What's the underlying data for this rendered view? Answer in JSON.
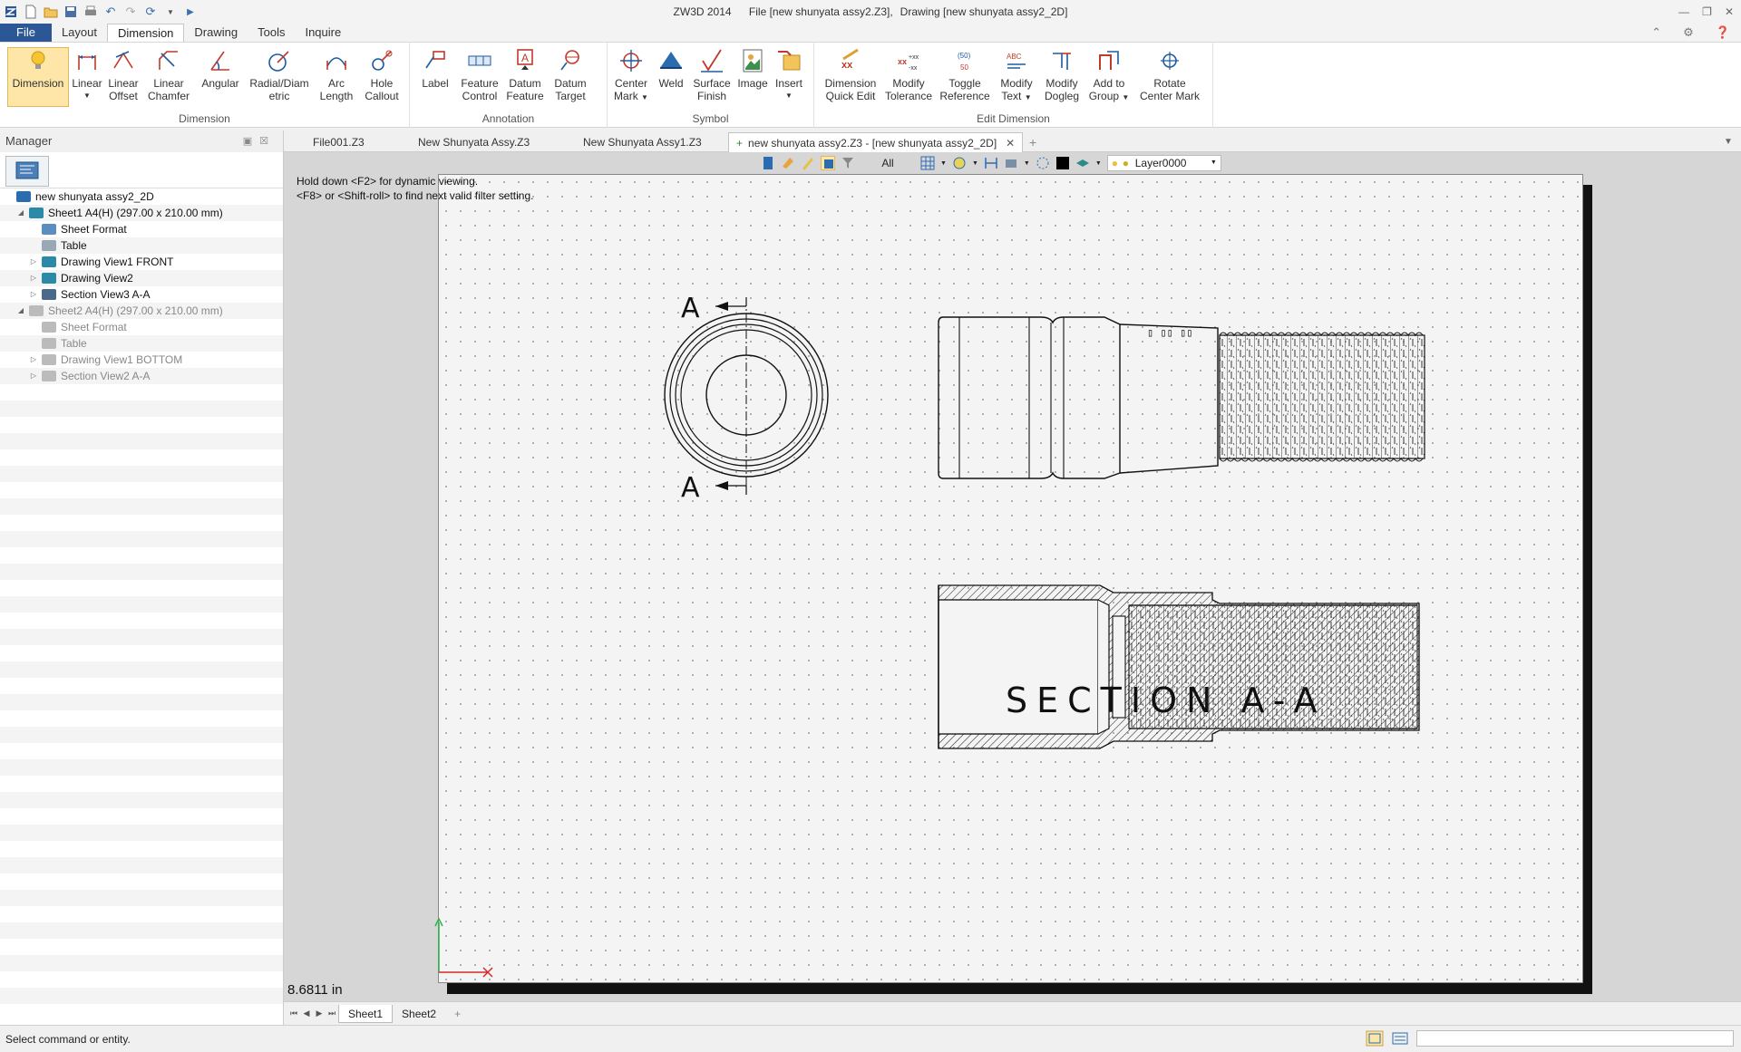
{
  "app": {
    "name": "ZW3D 2014",
    "file_caption": "File [new shunyata assy2.Z3],",
    "drawing_caption": "Drawing [new shunyata assy2_2D]"
  },
  "menu": {
    "tabs": [
      "File",
      "Layout",
      "Dimension",
      "Drawing",
      "Tools",
      "Inquire"
    ],
    "active": "Dimension"
  },
  "ribbon": {
    "groups": {
      "dimension": "Dimension",
      "annotation": "Annotation",
      "symbol": "Symbol",
      "edit_dimension": "Edit Dimension"
    },
    "buttons": {
      "dimension": "Dimension",
      "linear": "Linear",
      "linear_offset_1": "Linear",
      "linear_offset_2": "Offset",
      "linear_chamfer_1": "Linear",
      "linear_chamfer_2": "Chamfer",
      "angular": "Angular",
      "radial_1": "Radial/Diam",
      "radial_2": "etric",
      "arc_1": "Arc",
      "arc_2": "Length",
      "hole_1": "Hole",
      "hole_2": "Callout",
      "label": "Label",
      "feature_control_1": "Feature",
      "feature_control_2": "Control",
      "datum_feature_1": "Datum",
      "datum_feature_2": "Feature",
      "datum_target_1": "Datum",
      "datum_target_2": "Target",
      "center_mark_1": "Center",
      "center_mark_2": "Mark",
      "weld": "Weld",
      "surface_finish_1": "Surface",
      "surface_finish_2": "Finish",
      "image": "Image",
      "insert": "Insert",
      "dim_quick_edit_1": "Dimension",
      "dim_quick_edit_2": "Quick Edit",
      "modify_tolerance_1": "Modify",
      "modify_tolerance_2": "Tolerance",
      "toggle_reference_1": "Toggle",
      "toggle_reference_2": "Reference",
      "modify_text_1": "Modify",
      "modify_text_2": "Text",
      "modify_dogleg_1": "Modify",
      "modify_dogleg_2": "Dogleg",
      "add_to_group_1": "Add to",
      "add_to_group_2": "Group",
      "rotate_center_mark_1": "Rotate",
      "rotate_center_mark_2": "Center Mark"
    }
  },
  "manager": {
    "title": "Manager",
    "tree": [
      {
        "label": "new shunyata assy2_2D",
        "level": 0,
        "dim": false,
        "icon": "drawing-root-icon"
      },
      {
        "label": "Sheet1 A4(H) (297.00 x 210.00 mm)",
        "level": 1,
        "dim": false,
        "icon": "sheet-icon",
        "expand": "open"
      },
      {
        "label": "Sheet Format",
        "level": 2,
        "dim": false,
        "icon": "sheet-format-icon"
      },
      {
        "label": "Table",
        "level": 2,
        "dim": false,
        "icon": "table-icon"
      },
      {
        "label": "Drawing View1 FRONT",
        "level": 2,
        "dim": false,
        "icon": "view-icon",
        "expand": "closed"
      },
      {
        "label": "Drawing View2",
        "level": 2,
        "dim": false,
        "icon": "view-icon",
        "expand": "closed"
      },
      {
        "label": "Section View3 A-A",
        "level": 2,
        "dim": false,
        "icon": "section-view-icon",
        "expand": "closed"
      },
      {
        "label": "Sheet2 A4(H) (297.00 x 210.00 mm)",
        "level": 1,
        "dim": true,
        "icon": "sheet-icon",
        "expand": "open"
      },
      {
        "label": "Sheet Format",
        "level": 2,
        "dim": true,
        "icon": "sheet-format-icon"
      },
      {
        "label": "Table",
        "level": 2,
        "dim": true,
        "icon": "table-icon"
      },
      {
        "label": "Drawing View1 BOTTOM",
        "level": 2,
        "dim": true,
        "icon": "view-icon",
        "expand": "closed"
      },
      {
        "label": "Section View2 A-A",
        "level": 2,
        "dim": true,
        "icon": "section-view-icon",
        "expand": "closed"
      }
    ]
  },
  "doc_tabs": [
    "File001.Z3",
    "New Shunyata Assy.Z3",
    "New Shunyata Assy1.Z3",
    "new shunyata assy2.Z3 - [new shunyata assy2_2D]"
  ],
  "canvas": {
    "filter": "All",
    "layer": "Layer0000",
    "hint_line1": "Hold down <F2> for dynamic viewing.",
    "hint_line2": "<F8> or <Shift-roll> to find next valid filter setting.",
    "section_label": "SECTION A-A",
    "section_mark_top": "A",
    "section_mark_bottom": "A",
    "coordinate": "8.6811 in"
  },
  "sheet_tabs": [
    "Sheet1",
    "Sheet2"
  ],
  "status": {
    "message": "Select command or entity."
  },
  "colors": {
    "file_tab": "#2b5797",
    "selected_button": "#fde6a8",
    "sheet_shadow": "#111111"
  }
}
